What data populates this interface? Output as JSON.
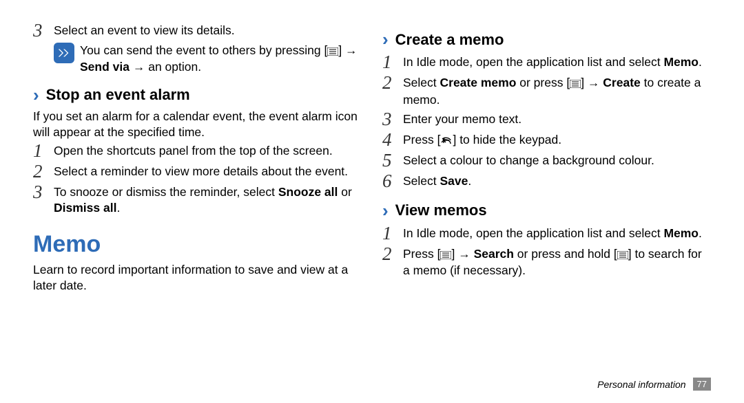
{
  "left": {
    "step3_top": "Select an event to view its details.",
    "note_pre": "You can send the event to others by pressing [",
    "note_post_arrow": "] → ",
    "note_send_via": "Send via",
    "note_suffix": " → an option.",
    "stop_heading": "Stop an event alarm",
    "stop_intro": "If you set an alarm for a calendar event, the event alarm icon will appear at the specified time.",
    "s1": "Open the shortcuts panel from the top of the screen.",
    "s2": "Select a reminder to view more details about the event.",
    "s3_pre": "To snooze or dismiss the reminder, select ",
    "s3_snooze": "Snooze all",
    "s3_mid": " or ",
    "s3_dismiss": "Dismiss all",
    "s3_end": ".",
    "memo_h1": "Memo",
    "memo_intro": "Learn to record important information to save and view at a later date."
  },
  "right": {
    "create_heading": "Create a memo",
    "c1_pre": "In Idle mode, open the application list and select ",
    "c1_memo": "Memo",
    "c1_end": ".",
    "c2_pre": "Select ",
    "c2_creatememo": "Create memo",
    "c2_mid": " or press [",
    "c2_post_arrow": "] → ",
    "c2_create": "Create",
    "c2_suffix": " to create a memo.",
    "c3": "Enter your memo text.",
    "c4_pre": "Press [",
    "c4_post": "] to hide the keypad.",
    "c5": "Select a colour to change a background colour.",
    "c6_pre": "Select ",
    "c6_save": "Save",
    "c6_end": ".",
    "view_heading": "View memos",
    "v1_pre": "In Idle mode, open the application list and select ",
    "v1_memo": "Memo",
    "v1_end": ".",
    "v2_pre": "Press [",
    "v2_mid1": "] → ",
    "v2_search": "Search",
    "v2_mid2": " or press and hold [",
    "v2_suffix": "] to search for a memo (if necessary)."
  },
  "footer": {
    "section": "Personal information",
    "page": "77"
  }
}
